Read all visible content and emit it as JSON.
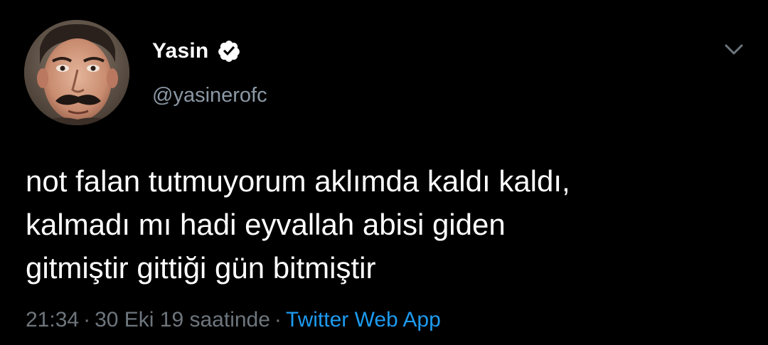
{
  "tweet": {
    "author": {
      "display_name": "Yasin",
      "handle": "@yasinerofc",
      "verified": true,
      "avatar_icon": "profile-photo"
    },
    "text_lines": [
      "not falan tutmuyorum aklımda kaldı kaldı,",
      "kalmadı mı hadi eyvallah abisi giden",
      "gitmiştir gittiği gün bitmiştir"
    ],
    "meta": {
      "time": "21:34",
      "separator": "·",
      "date_text": "30 Eki 19 saatinde",
      "source": "Twitter Web App"
    },
    "menu_icon": "chevron-down-icon"
  },
  "colors": {
    "background": "#000000",
    "text_primary": "#ffffff",
    "text_secondary": "#8b98a5",
    "meta_text": "#6e767d",
    "link": "#1d9bf0",
    "verified_badge": "#ffffff"
  }
}
